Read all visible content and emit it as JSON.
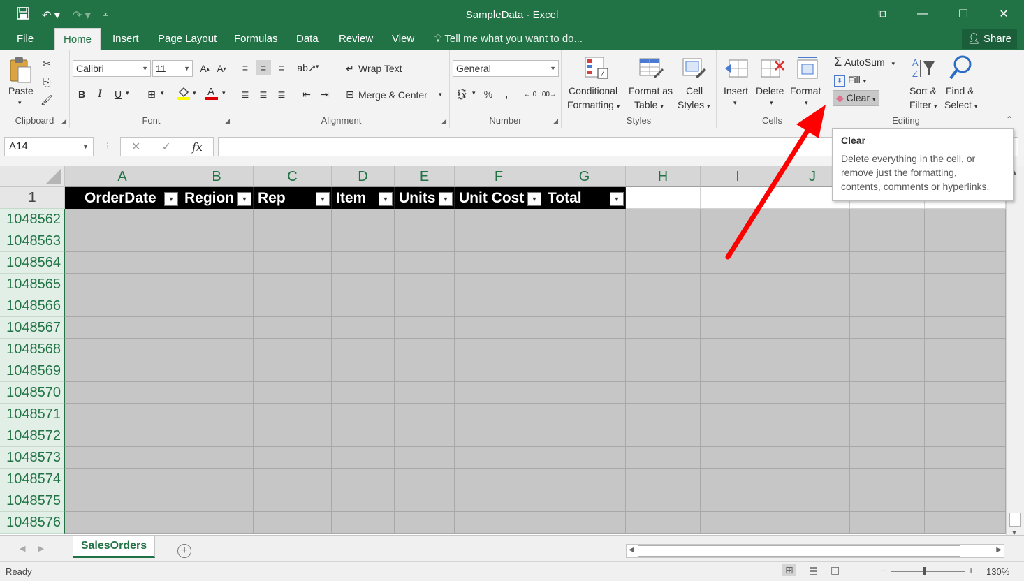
{
  "window": {
    "title": "SampleData - Excel",
    "qat": {
      "save_icon": "save-icon",
      "undo_icon": "undo-icon",
      "redo_icon": "redo-icon",
      "customize_icon": "customize-qat-icon"
    }
  },
  "tabs": [
    {
      "label": "File"
    },
    {
      "label": "Home"
    },
    {
      "label": "Insert"
    },
    {
      "label": "Page Layout"
    },
    {
      "label": "Formulas"
    },
    {
      "label": "Data"
    },
    {
      "label": "Review"
    },
    {
      "label": "View"
    }
  ],
  "tell_me": "Tell me what you want to do...",
  "share_label": "Share",
  "ribbon": {
    "clipboard": {
      "label": "Clipboard",
      "paste": "Paste"
    },
    "font": {
      "label": "Font",
      "font_name": "Calibri",
      "font_size": "11",
      "bold": "B",
      "italic": "I",
      "underline": "U"
    },
    "alignment": {
      "label": "Alignment",
      "wrap_text": "Wrap Text",
      "merge_center": "Merge & Center"
    },
    "number": {
      "label": "Number",
      "format": "General",
      "percent": "%",
      "comma": ","
    },
    "styles": {
      "label": "Styles",
      "conditional_1": "Conditional",
      "conditional_2": "Formatting",
      "format_as_1": "Format as",
      "format_as_2": "Table",
      "cell_styles_1": "Cell",
      "cell_styles_2": "Styles"
    },
    "cells": {
      "label": "Cells",
      "insert": "Insert",
      "delete": "Delete",
      "format": "Format"
    },
    "editing": {
      "label": "Editing",
      "autosum": "AutoSum",
      "fill": "Fill",
      "clear": "Clear",
      "sort_1": "Sort &",
      "sort_2": "Filter",
      "find_1": "Find &",
      "find_2": "Select"
    }
  },
  "formula_bar": {
    "name_box": "A14",
    "fx": "fx",
    "value": ""
  },
  "columns": [
    "A",
    "B",
    "C",
    "D",
    "E",
    "F",
    "G",
    "H",
    "I",
    "J"
  ],
  "header_row_number": "1",
  "table_headers": [
    "OrderDate",
    "Region",
    "Rep",
    "Item",
    "Units",
    "Unit Cost",
    "Total"
  ],
  "row_numbers": [
    "1048562",
    "1048563",
    "1048564",
    "1048565",
    "1048566",
    "1048567",
    "1048568",
    "1048569",
    "1048570",
    "1048571",
    "1048572",
    "1048573",
    "1048574",
    "1048575",
    "1048576"
  ],
  "sheet_tab": "SalesOrders",
  "status": {
    "ready": "Ready",
    "zoom": "130%"
  },
  "tooltip": {
    "title": "Clear",
    "line1": "Delete everything in the cell, or",
    "line2": "remove just the formatting,",
    "line3": "contents, comments or hyperlinks."
  },
  "colors": {
    "excel_green": "#217346",
    "annotation_arrow": "#ff0000",
    "selected_cells": "#c6c6c6"
  }
}
